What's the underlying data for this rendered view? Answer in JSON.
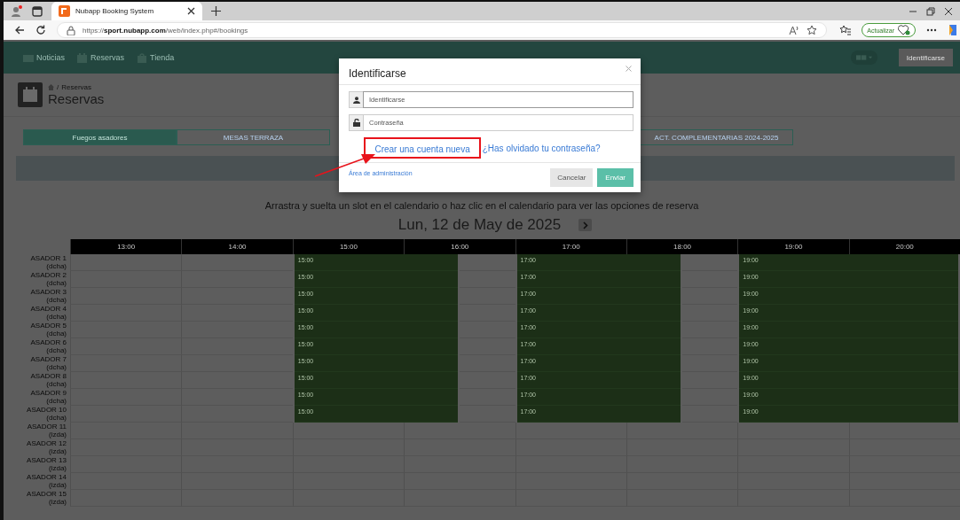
{
  "browser": {
    "tab_title": "Nubapp Booking System",
    "url": "https://**sport.nubapp.com**/web/index.php#/bookings",
    "update_button": "Actualizar"
  },
  "navbar": {
    "items": [
      "Noticias",
      "Reservas",
      "Tienda"
    ],
    "login_button": "Identificarse"
  },
  "header": {
    "breadcrumb_separator": "/",
    "breadcrumb": "Reservas",
    "title": "Reservas"
  },
  "tabs": [
    {
      "label": "Fuegos asadores",
      "selected": true
    },
    {
      "label": "MESAS TERRAZA",
      "selected": false
    },
    {
      "label": "ACT. COMPLEMENTARIAS 2024-2025",
      "selected": false
    }
  ],
  "instructions": "Arrastra y suelta un slot en el calendario o haz clic en el calendario para ver las opciones de reserva",
  "date": "Lun, 12 de May de 2025",
  "calendar": {
    "hours": [
      "13:00",
      "14:00",
      "15:00",
      "16:00",
      "17:00",
      "18:00",
      "19:00",
      "20:00"
    ],
    "rows": [
      {
        "name": "ASADOR 1",
        "side": "(dcha)",
        "bookings": [
          "15:00",
          "17:00",
          "19:00"
        ]
      },
      {
        "name": "ASADOR 2",
        "side": "(dcha)",
        "bookings": [
          "15:00",
          "17:00",
          "19:00"
        ]
      },
      {
        "name": "ASADOR 3",
        "side": "(dcha)",
        "bookings": [
          "15:00",
          "17:00",
          "19:00"
        ]
      },
      {
        "name": "ASADOR 4",
        "side": "(dcha)",
        "bookings": [
          "15:00",
          "17:00",
          "19:00"
        ]
      },
      {
        "name": "ASADOR 5",
        "side": "(dcha)",
        "bookings": [
          "15:00",
          "17:00",
          "19:00"
        ]
      },
      {
        "name": "ASADOR 6",
        "side": "(dcha)",
        "bookings": [
          "15:00",
          "17:00",
          "19:00"
        ]
      },
      {
        "name": "ASADOR 7",
        "side": "(dcha)",
        "bookings": [
          "15:00",
          "17:00",
          "19:00"
        ]
      },
      {
        "name": "ASADOR 8",
        "side": "(dcha)",
        "bookings": [
          "15:00",
          "17:00",
          "19:00"
        ]
      },
      {
        "name": "ASADOR 9",
        "side": "(dcha)",
        "bookings": [
          "15:00",
          "17:00",
          "19:00"
        ]
      },
      {
        "name": "ASADOR 10",
        "side": "(dcha)",
        "bookings": [
          "15:00",
          "17:00",
          "19:00"
        ]
      },
      {
        "name": "ASADOR 11",
        "side": "(izda)",
        "bookings": []
      },
      {
        "name": "ASADOR 12",
        "side": "(izda)",
        "bookings": []
      },
      {
        "name": "ASADOR 13",
        "side": "(izda)",
        "bookings": []
      },
      {
        "name": "ASADOR 14",
        "side": "(izda)",
        "bookings": []
      },
      {
        "name": "ASADOR 15",
        "side": "(izda)",
        "bookings": []
      }
    ]
  },
  "modal": {
    "title": "Identificarse",
    "username": {
      "placeholder": "Identificarse"
    },
    "password": {
      "placeholder": "Contraseña"
    },
    "create_account_link": "Crear una cuenta nueva",
    "forgot_password_link": "¿Has olvidado tu contraseña?",
    "admin_link": "Área de administración",
    "cancel_button": "Cancelar",
    "submit_button": "Enviar"
  }
}
